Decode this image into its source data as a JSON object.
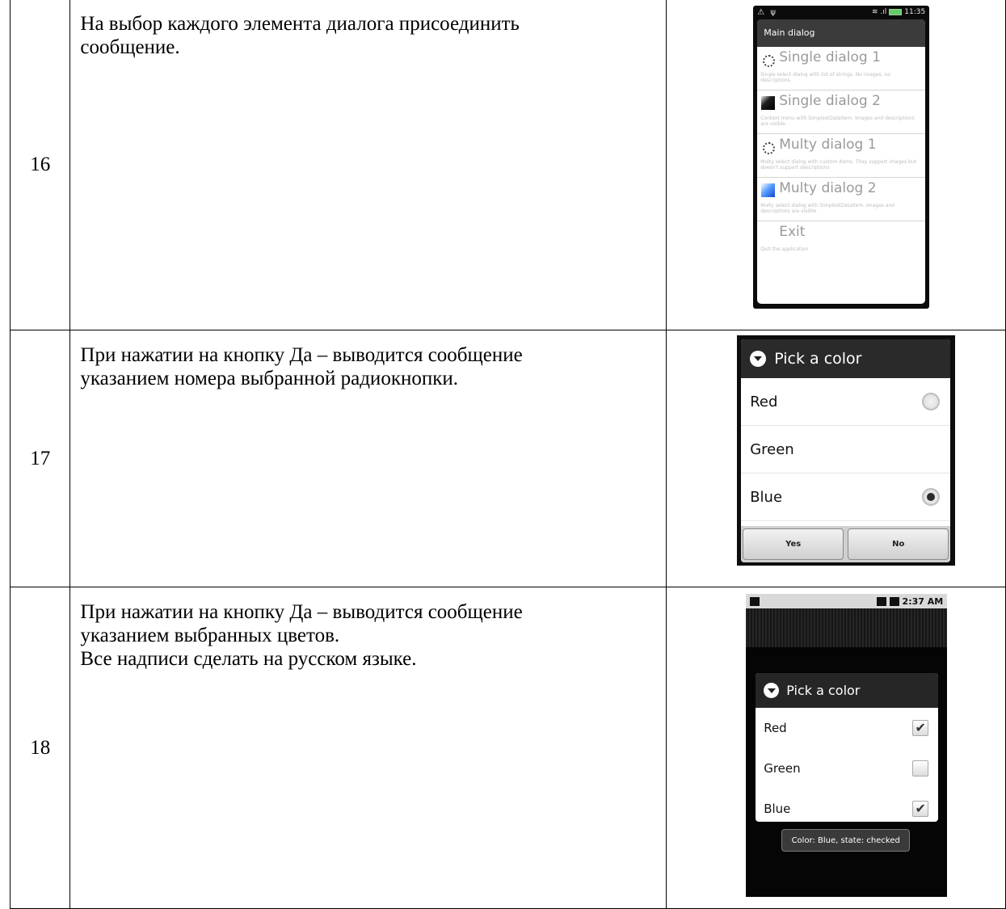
{
  "rows": [
    {
      "number": "16",
      "text_lines": [
        "На выбор каждого элемента диалога присоединить",
        "сообщение."
      ],
      "screenshot": {
        "status_time": "11:35",
        "dialog_title": "Main dialog",
        "items": [
          {
            "title": "Single dialog 1",
            "description": "Single select dialog with list of strings. No images, no descriptions.",
            "icon": "spinner-icon"
          },
          {
            "title": "Single dialog 2",
            "description": "Context menu with SimplestDataItem. Images and descriptions are visible",
            "icon": "black-square-icon"
          },
          {
            "title": "Multy dialog 1",
            "description": "Multy select dialog with custom items. They support images but doesn't support descriptions",
            "icon": "spinner-icon"
          },
          {
            "title": "Multy dialog 2",
            "description": "Multy select dialog with SimplestDataItem. Images and descriptions are visible",
            "icon": "blue-square-icon"
          },
          {
            "title": "Exit",
            "description": "Quit the application",
            "icon": ""
          }
        ]
      }
    },
    {
      "number": "17",
      "text_lines": [
        "При нажатии на кнопку Да – выводится сообщение",
        "указанием номера выбранной радиокнопки."
      ],
      "screenshot": {
        "dialog_title": "Pick a color",
        "options": [
          {
            "label": "Red",
            "selected": false
          },
          {
            "label": "Green",
            "selected": false
          },
          {
            "label": "Blue",
            "selected": true
          }
        ],
        "yes_label": "Yes",
        "no_label": "No"
      }
    },
    {
      "number": "18",
      "text_lines": [
        "При нажатии на кнопку Да – выводится сообщение",
        "указанием выбранных цветов.",
        "Все надписи сделать на русском языке."
      ],
      "screenshot": {
        "status_time": "2:37 AM",
        "dialog_title": "Pick a color",
        "options": [
          {
            "label": "Red",
            "checked": true
          },
          {
            "label": "Green",
            "checked": false
          },
          {
            "label": "Blue",
            "checked": true
          }
        ],
        "toast": "Color:  Blue, state: checked"
      }
    }
  ],
  "colors": {
    "blue_accent": "#1044d8",
    "dialog_header": "#2a2a2a"
  }
}
